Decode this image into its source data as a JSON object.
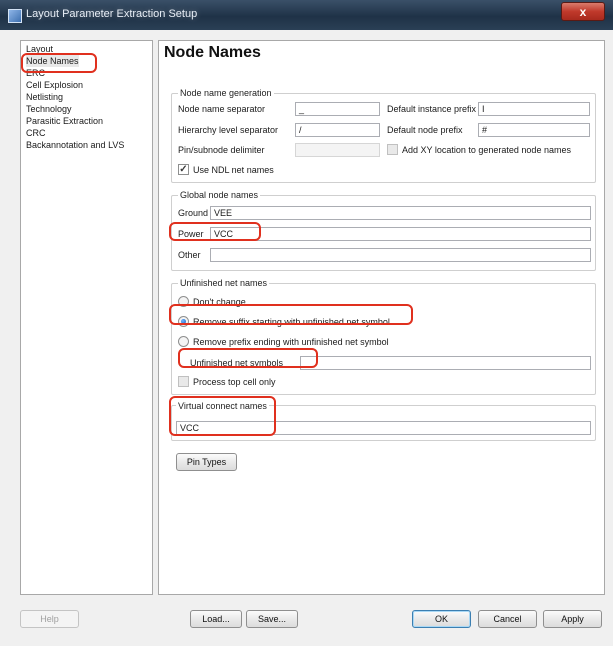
{
  "window": {
    "title": "Layout Parameter Extraction Setup",
    "close_glyph": "x"
  },
  "nav": {
    "items": [
      {
        "label": "Layout"
      },
      {
        "label": "Node Names",
        "selected": true
      },
      {
        "label": "ERC"
      },
      {
        "label": "Cell Explosion"
      },
      {
        "label": "Netlisting"
      },
      {
        "label": "Technology"
      },
      {
        "label": "Parasitic Extraction"
      },
      {
        "label": "CRC"
      },
      {
        "label": "Backannotation and LVS"
      }
    ]
  },
  "page": {
    "title": "Node Names",
    "generation": {
      "title": "Node name generation",
      "node_name_separator": {
        "label": "Node name separator",
        "value": "_"
      },
      "hierarchy_separator": {
        "label": "Hierarchy level separator",
        "value": "/"
      },
      "pin_subnode_delimiter": {
        "label": "Pin/subnode delimiter",
        "value": ""
      },
      "default_instance_prefix": {
        "label": "Default instance prefix",
        "value": "I"
      },
      "default_node_prefix": {
        "label": "Default node prefix",
        "value": "#"
      },
      "add_xy": {
        "label": "Add XY location to generated node names",
        "checked": false
      },
      "use_ndl": {
        "label": "Use NDL net names",
        "checked": true
      }
    },
    "global": {
      "title": "Global node names",
      "ground": {
        "label": "Ground",
        "value": "VEE"
      },
      "power": {
        "label": "Power",
        "value": "VCC"
      },
      "other": {
        "label": "Other",
        "value": ""
      }
    },
    "unfinished": {
      "title": "Unfinished net names",
      "options": [
        {
          "label": "Don't change",
          "checked": false
        },
        {
          "label": "Remove suffix starting with unfinished net symbol",
          "checked": true
        },
        {
          "label": "Remove prefix ending with unfinished net symbol",
          "checked": false
        }
      ],
      "symbols": {
        "label": "Unfinished net symbols",
        "value": ""
      },
      "process_top": {
        "label": "Process top cell only",
        "checked": false
      }
    },
    "virtual": {
      "title": "Virtual connect names",
      "value": "VCC"
    },
    "pin_types_label": "Pin Types"
  },
  "footer": {
    "help": "Help",
    "load": "Load...",
    "save": "Save...",
    "ok": "OK",
    "cancel": "Cancel",
    "apply": "Apply"
  },
  "colors": {
    "annotation": "#e0301e",
    "title_bar": "#1f3247"
  }
}
